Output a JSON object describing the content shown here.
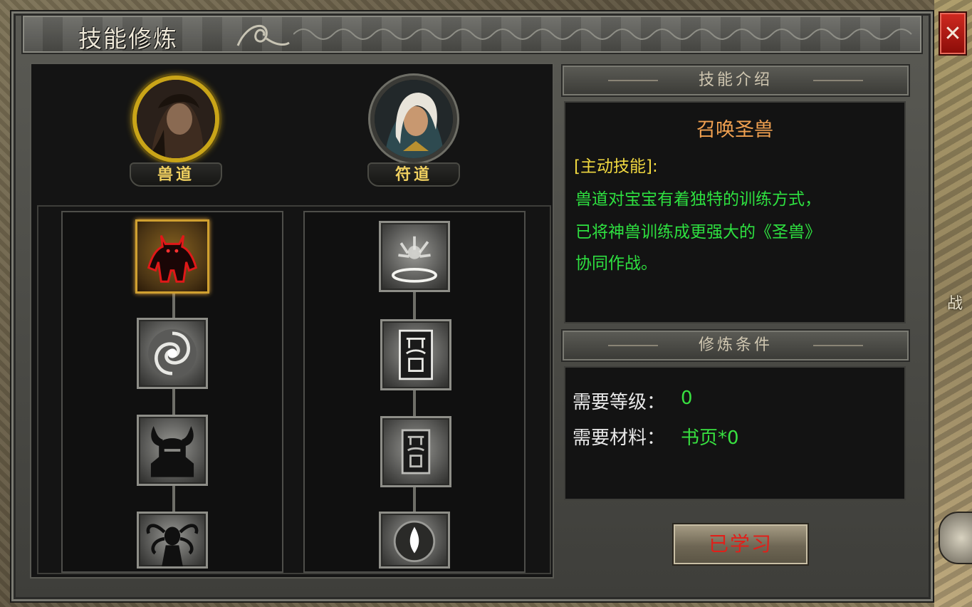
{
  "window": {
    "title": "技能修炼",
    "close_label": "✕"
  },
  "background": {
    "side_label": "战"
  },
  "heroes": [
    {
      "name": "兽道",
      "active": true
    },
    {
      "name": "符道",
      "active": false
    }
  ],
  "skill_trees": [
    {
      "path": "兽道",
      "skills": [
        "summon-beast-icon",
        "swirl-icon",
        "horned-helm-icon",
        "medusa-icon"
      ],
      "selected_index": 0
    },
    {
      "path": "符道",
      "skills": [
        "ring-icon",
        "talisman-icon",
        "talisman-icon",
        "flame-orb-icon"
      ],
      "selected_index": -1
    }
  ],
  "skill_intro": {
    "header": "技能介绍",
    "name": "召唤圣兽",
    "type": "[主动技能]:",
    "description": [
      "兽道对宝宝有着独特的训练方式，",
      "已将神兽训练成更强大的《圣兽》",
      "协同作战。"
    ]
  },
  "requirements": {
    "header": "修炼条件",
    "level_label": "需要等级：",
    "level_value": "0",
    "material_label": "需要材料：",
    "material_value": "书页*0"
  },
  "learn_button": {
    "label": "已学习"
  },
  "colors": {
    "accent_gold": "#c9a418",
    "desc_green": "#2ee040",
    "skill_name_orange": "#f0a050",
    "learned_red": "#e0201a"
  }
}
